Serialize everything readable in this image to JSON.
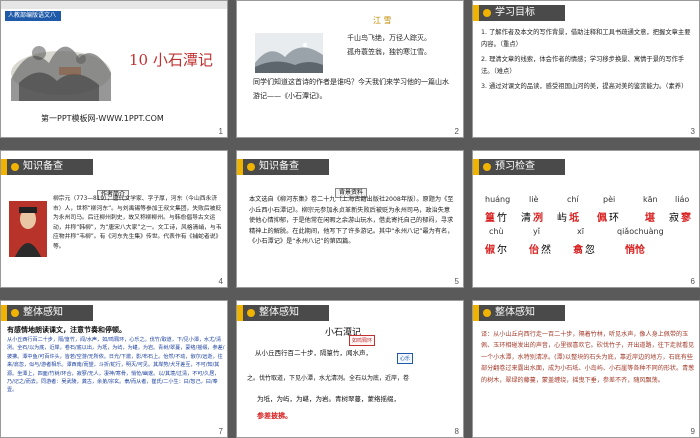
{
  "slides": [
    {
      "number": "1",
      "header_band": "人教部编版语文八年级",
      "title": "10 小石潭记",
      "footer": "第一PPT模板网-WWW.1PPT.COM"
    },
    {
      "number": "2",
      "poem_title": "江 雪",
      "poem_line1": "千山鸟飞绝，万径人踪灭。",
      "poem_line2": "孤舟蓑笠翁，独钓寒江雪。",
      "intro": "同学们知道这首诗的作者是谁吗？今天我们来学习他的一篇山水游记——《小石潭记》。"
    },
    {
      "number": "3",
      "section": "学习目标",
      "items": [
        "1. 了解作者及本文的写作背景，借助注释和工具书疏通文意，把握文章主要内容。（重点）",
        "2. 理清文章的线索，体会作者的情感；学习移步换景、寓情于景的写作手法。（难点）",
        "3. 通过对课文的品读，感受祖国山河的美，提高对美的鉴赏能力。（素养）"
      ]
    },
    {
      "number": "4",
      "section": "知识备查",
      "tag": "作者简介",
      "text": "柳宗元（773—819），唐代文学家、字子厚，河东（今山西永济市）人，世称“柳河东”。与刘禹锡等参加王叔文集团，失败后被贬为永州司马。后迁柳州刺史，故又称柳柳州。与韩愈倡导古文运动，并称“韩柳”，为“唐宋八大家”之一。文工诗，风格清峭，与韦应物并称“韦柳”。有《河东先生集》传世。代表作有《捕蛇者说》等。"
    },
    {
      "number": "5",
      "section": "知识备查",
      "tag": "背景资料",
      "text": "本文选自《柳河东集》卷二十九（上海古籍出版社2008年版）。原题为《至小丘西小石潭记》。柳宗元参加永贞革新失败后被贬为永州司马，政治失意使他心情抑郁，于是他常在闲暇之余游山玩水，借此寄托自己的郁闷，寻求精神上的解脱。在此期间，他写下了许多游记。其中“永州八记”最为有名，《小石潭记》是“永州八记”的第四篇。"
    },
    {
      "number": "6",
      "section": "预习检查",
      "row1": [
        {
          "pinyin": "huáng",
          "hanzi": "篁"
        },
        {
          "pinyin": "liè",
          "hanzi": "冽"
        },
        {
          "pinyin": "chí",
          "hanzi": "坻"
        },
        {
          "pinyin": "pèi",
          "hanzi": "佩"
        },
        {
          "pinyin": "kān",
          "hanzi": "堪"
        },
        {
          "pinyin": "liáo",
          "hanzi": "寥"
        }
      ],
      "row1_text": [
        "竹",
        "清",
        "屿",
        "环",
        "嵁",
        "寂"
      ],
      "row2": [
        {
          "pinyin": "chù",
          "hanzi": "俶"
        },
        {
          "pinyin": "yǐ",
          "hanzi": "佁"
        },
        {
          "pinyin": "xī",
          "hanzi": "翕"
        },
        {
          "pinyin": "qiǎochuàng",
          "hanzi": "悄怆"
        }
      ],
      "row2_text": [
        "尔",
        "然",
        "忽"
      ]
    },
    {
      "number": "7",
      "section": "整体感知",
      "prompt": "有感情地朗读课文，注意节奏和停顿。",
      "text": "从小丘西行百二十步，隔/篁竹，闻/水声，如/鸣珮环，心乐之。伐竹/取道，下/见小潭，水尤/清冽。全石/以为底，近岸，卷石/底以出，为坻，为屿，为嵁，为岩。青树/翠蔓，蒙络/摇缀，参差/披拂。潭中鱼/可百许头，皆若/空游/无所依。日光/下澈，影/布石上。佁然/不动，俶尔/远逝，往来/翕忽，似与/游者相乐。潭西南/而望，斗折/蛇行，明灭/可见。其岸势/犬牙差互，不可/知/其源。坐潭上，四面/竹树/环合，寂寥/无人，凄神/寒骨，悄怆/幽邃。以/其境/过清，不可/久居，乃/记之/而去。同游者：吴武陵，龚古，余弟/宗玄。隶/而从者，崔氏/二小生：曰/恕己，曰/奉壹。"
    },
    {
      "number": "8",
      "section": "整体感知",
      "title": "小石潭记",
      "line1": "从小丘西行百二十步，隔篁竹，闻水声，",
      "line2": "之。伐竹取道，下见小潭，水尤清冽。全石以为底，近岸，卷",
      "line3": "为坻，为屿，为嵁，为岩。青树翠蔓，蒙络摇缀，",
      "line4": "参差披拂。",
      "notes": [
        "如鸣珮环",
        "心乐"
      ]
    },
    {
      "number": "9",
      "section": "整体感知",
      "text": "译：从小山丘向西行走一百二十步，隔着竹林，听见水声，像人身上佩带的玉佩、玉环相碰发出的声音，心里很喜欢它。砍伐竹子，开出道路，往下走就看见一个小水潭，水特别清凉。(潭)以整块的石头为底，靠近岸边的地方，石底有些部分翻卷过来露出水面，成为小石坻、小岛屿、小石崖等各种不同的形状。青葱的树木，翠绿的藤蔓，蒙盖缠绕，摇曳下垂，参差不齐，随风飘荡。"
    }
  ]
}
